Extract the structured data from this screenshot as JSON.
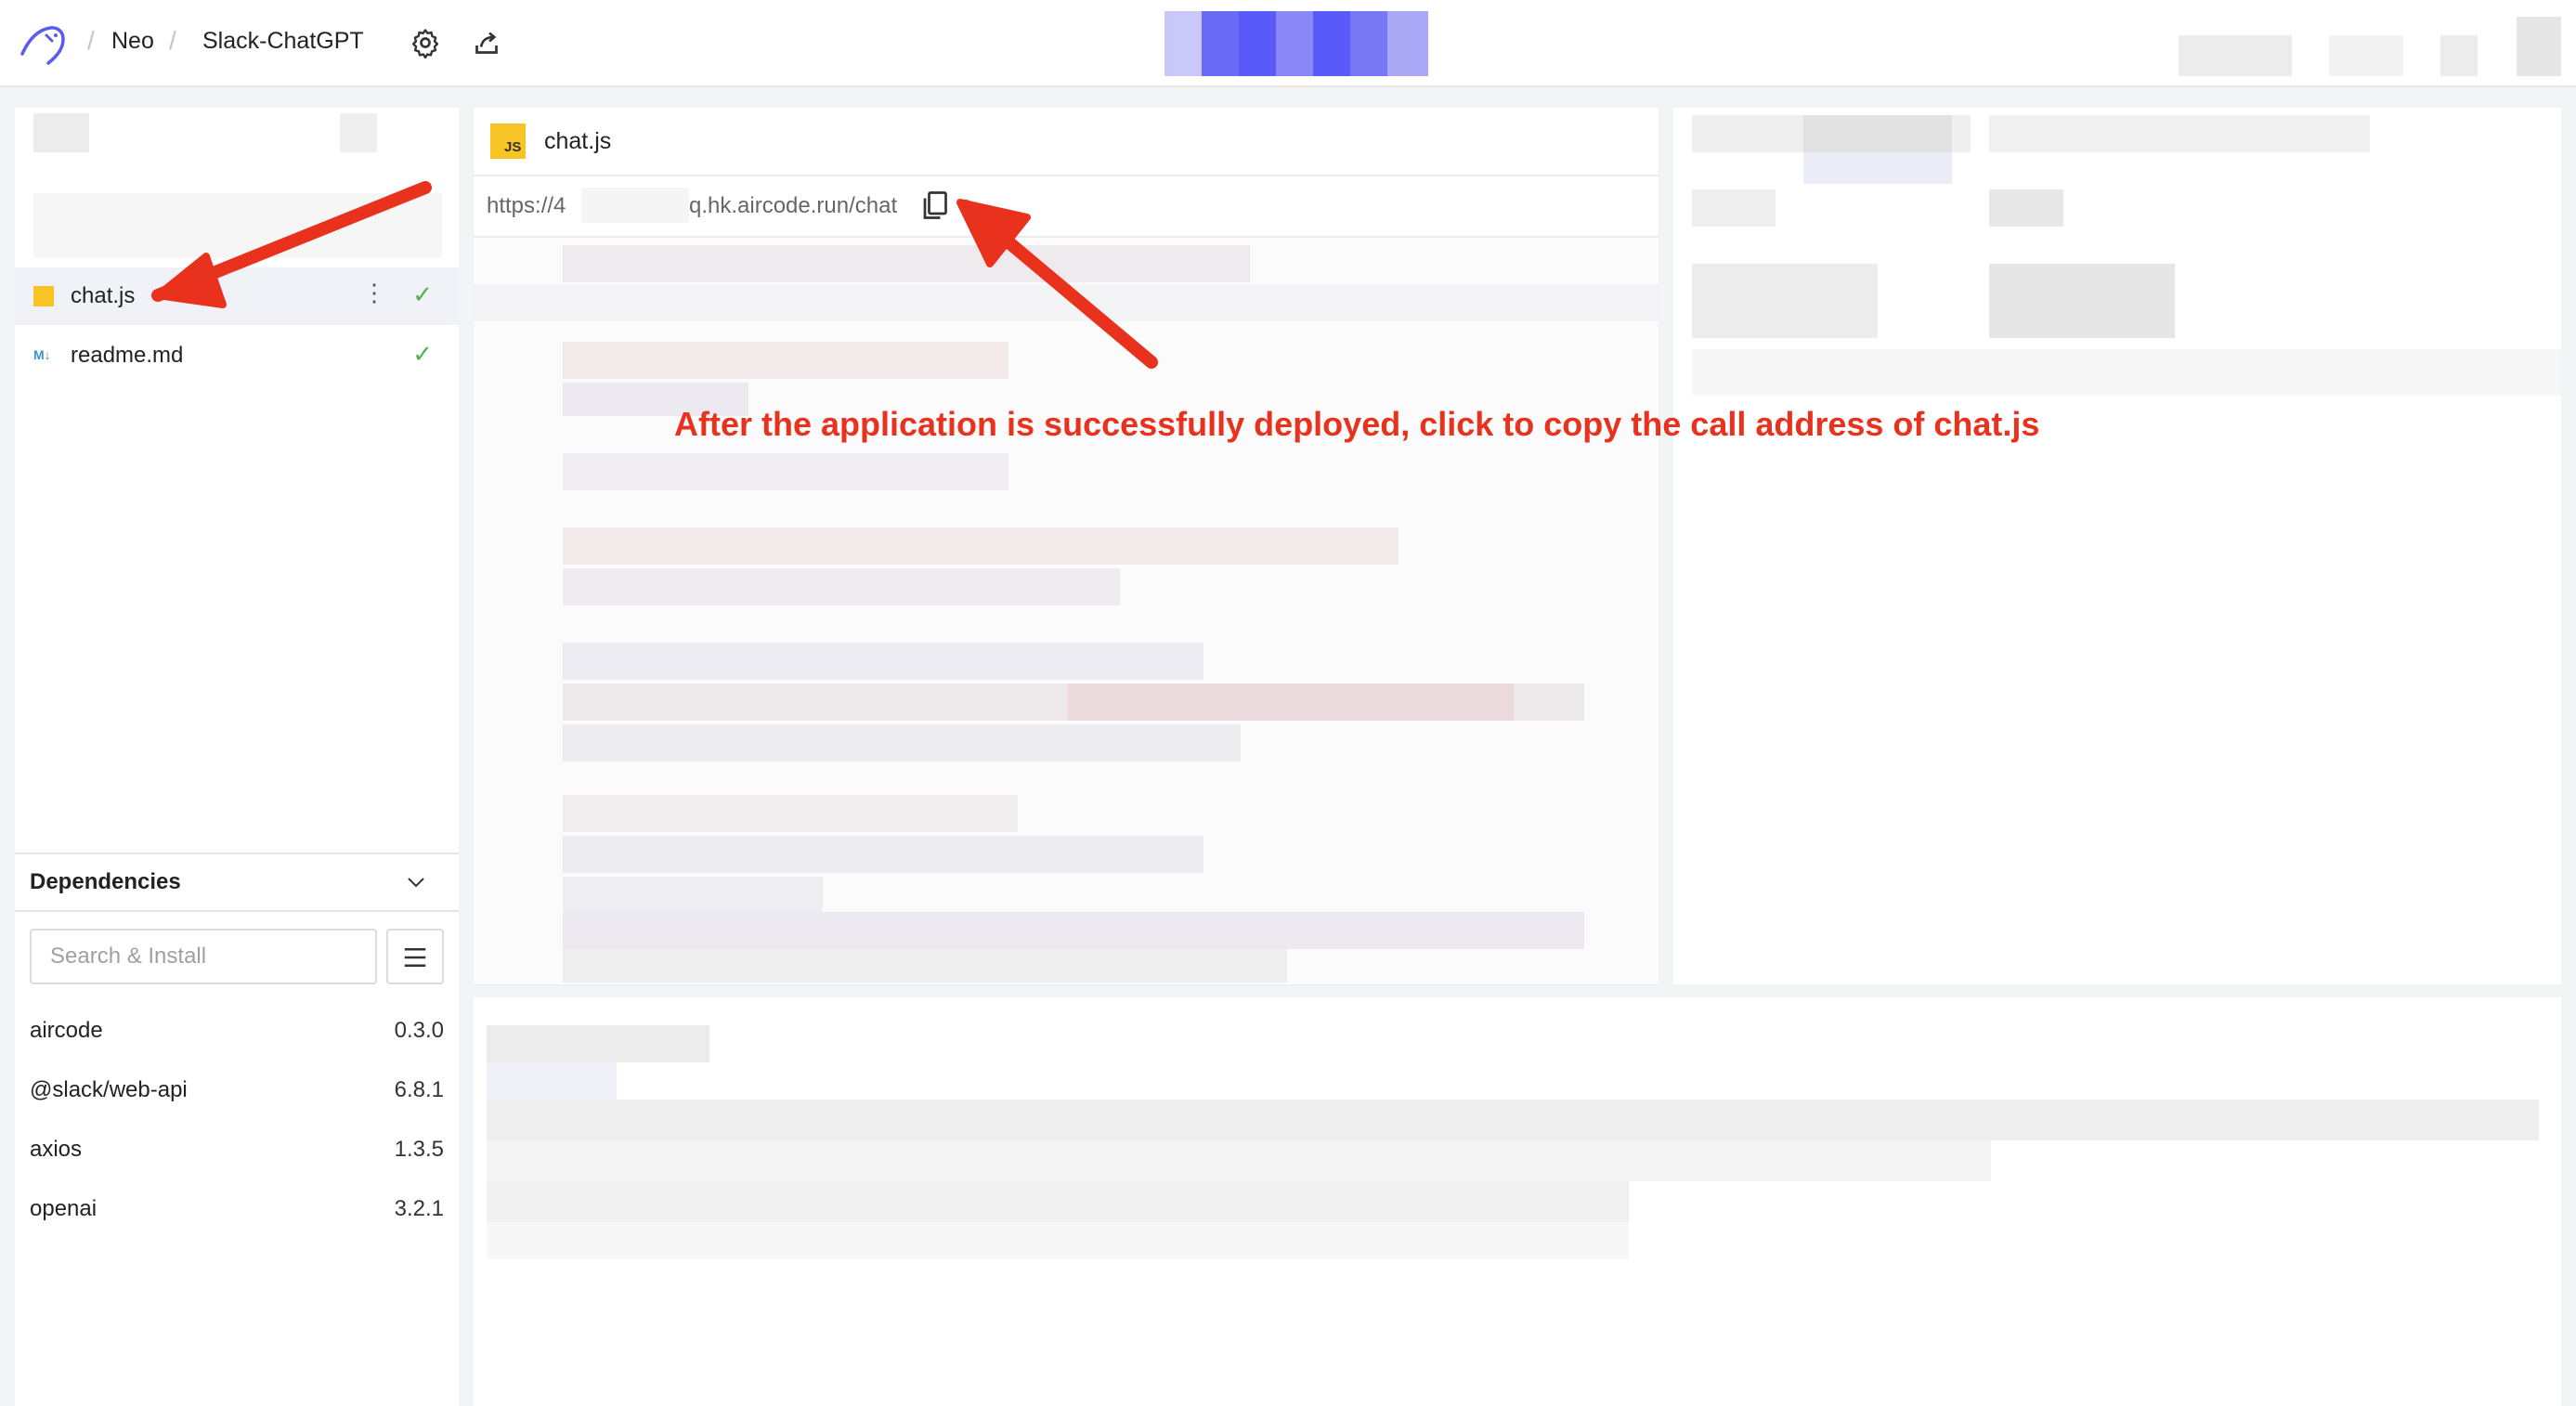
{
  "breadcrumb": {
    "user": "Neo",
    "app": "Slack-ChatGPT",
    "separator": "/"
  },
  "toolbar": {
    "settings_icon": "gear-icon",
    "share_icon": "share-icon"
  },
  "files": [
    {
      "name": "chat.js",
      "icon": "js-file-icon",
      "status": "✓",
      "active": true
    },
    {
      "name": "readme.md",
      "icon": "markdown-file-icon",
      "status": "✓",
      "active": false
    }
  ],
  "dependencies": {
    "title": "Dependencies",
    "search_placeholder": "Search & Install",
    "items": [
      {
        "name": "aircode",
        "version": "0.3.0"
      },
      {
        "name": "@slack/web-api",
        "version": "6.8.1"
      },
      {
        "name": "axios",
        "version": "1.3.5"
      },
      {
        "name": "openai",
        "version": "3.2.1"
      }
    ]
  },
  "editor": {
    "tab_title": "chat.js",
    "js_badge": "JS",
    "url_prefix": "https://4",
    "url_suffix": "q.hk.aircode.run/chat"
  },
  "annotation": {
    "text": "After the application is successfully deployed, click to copy the call address of chat.js",
    "color": "#e8321e"
  },
  "colors": {
    "accent": "#5a5cf0",
    "check": "#4cb34c",
    "js_yellow": "#f7c325"
  }
}
